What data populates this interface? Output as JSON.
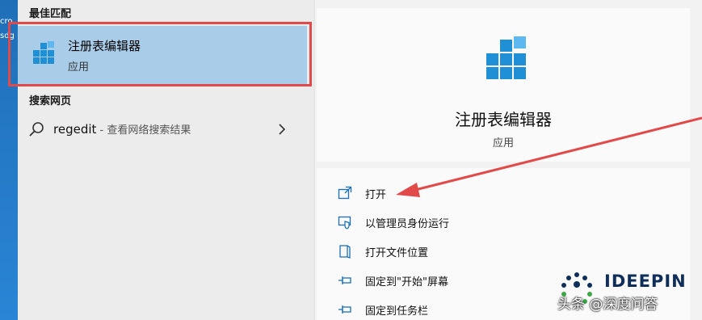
{
  "desktop": {
    "fragment_lines": [
      "cro",
      "sdg"
    ]
  },
  "left": {
    "best_match_heading": "最佳匹配",
    "best_match": {
      "title": "注册表编辑器",
      "subtitle": "应用"
    },
    "web_heading": "搜索网页",
    "web_result": {
      "query": "regedit",
      "hint": " - 查看网络搜索结果"
    }
  },
  "right": {
    "app_title": "注册表编辑器",
    "app_subtitle": "应用",
    "actions": [
      {
        "label": "打开",
        "icon": "open-window-icon"
      },
      {
        "label": "以管理员身份运行",
        "icon": "shield-run-icon"
      },
      {
        "label": "打开文件位置",
        "icon": "file-location-icon"
      },
      {
        "label": "固定到\"开始\"屏幕",
        "icon": "pin-icon"
      },
      {
        "label": "固定到任务栏",
        "icon": "pin-icon"
      }
    ]
  },
  "watermark": {
    "brand": "IDEEPIN",
    "byline": "头条 @深度问答"
  },
  "colors": {
    "selection": "#a9cde9",
    "highlight_box": "#e24a4a",
    "arrow": "#e24a4a",
    "icon_blue": "#1f8fd6"
  }
}
